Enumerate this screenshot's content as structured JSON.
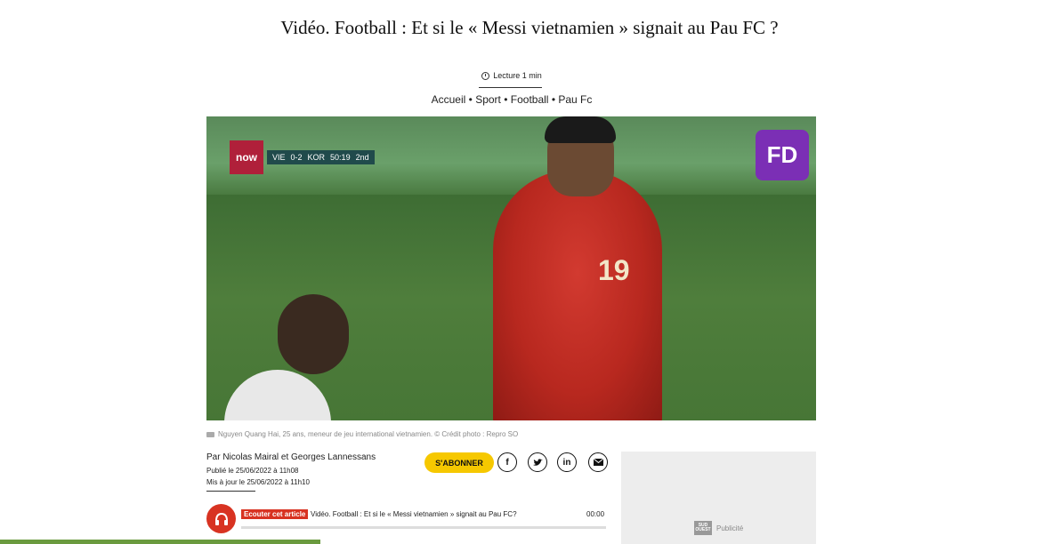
{
  "article": {
    "title": "Vidéo. Football : Et si le « Messi vietnamien » signait au Pau FC ?",
    "reading_time": "Lecture 1 min",
    "breadcrumb": [
      "Accueil",
      "Sport",
      "Football",
      "Pau Fc"
    ],
    "breadcrumb_separator": "•"
  },
  "video": {
    "channel_badge": "now",
    "score": {
      "home": "VIE",
      "score": "0-2",
      "away": "KOR",
      "clock": "50:19",
      "period": "2nd"
    },
    "jersey_number": "19",
    "channel_logo_icon": "fd-logo-icon"
  },
  "caption": "Nguyen Quang Hai, 25 ans, meneur de jeu international vietnamien. © Crédit photo : Repro SO",
  "byline": {
    "author": "Par Nicolas Mairal et Georges Lannessans",
    "published": "Publié le 25/06/2022 à 11h08",
    "updated": "Mis à jour le 25/06/2022 à 11h10"
  },
  "actions": {
    "subscribe": "S'ABONNER",
    "social": [
      "facebook-icon",
      "twitter-icon",
      "linkedin-icon",
      "email-icon"
    ]
  },
  "audio": {
    "tag": "Ecouter cet article",
    "title": "Vidéo. Football : Et si le « Messi vietnamien » signait au Pau FC?",
    "time": "00:00"
  },
  "ad": {
    "logo": "SUD OUEST",
    "label": "Publicité"
  },
  "colors": {
    "accent_red": "#d83322",
    "subscribe_yellow": "#f6c800"
  }
}
